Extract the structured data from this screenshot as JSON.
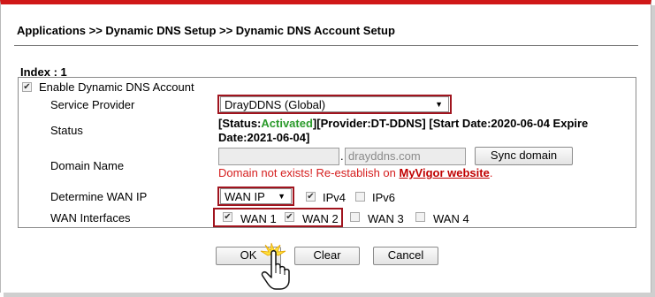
{
  "breadcrumb": "Applications >> Dynamic DNS Setup >> Dynamic DNS Account Setup",
  "index_label": "Index : 1",
  "enable": {
    "label": "Enable Dynamic DNS Account",
    "checked": true
  },
  "service_provider": {
    "label": "Service Provider",
    "value": "DrayDDNS (Global)"
  },
  "status": {
    "label": "Status",
    "prefix": "[Status:",
    "state": "Activated",
    "rest_line1": "][Provider:DT-DDNS] [Start Date:2020-06-04 Expire",
    "line2": "Date:2021-06-04]"
  },
  "domain": {
    "label": "Domain Name",
    "host_value": "",
    "separator": ".",
    "suffix": "drayddns.com",
    "sync_button": "Sync domain",
    "error_text": "Domain not exists! Re-establish on ",
    "error_link": "MyVigor website",
    "error_end": "."
  },
  "wan_ip": {
    "label": "Determine WAN IP",
    "value": "WAN IP",
    "ipv4_label": "IPv4",
    "ipv4_checked": true,
    "ipv6_label": "IPv6",
    "ipv6_checked": false
  },
  "wan_interfaces": {
    "label": "WAN Interfaces",
    "items": [
      {
        "label": "WAN 1",
        "checked": true
      },
      {
        "label": "WAN 2",
        "checked": true
      },
      {
        "label": "WAN 3",
        "checked": false
      },
      {
        "label": "WAN 4",
        "checked": false
      }
    ]
  },
  "buttons": {
    "ok": "OK",
    "clear": "Clear",
    "cancel": "Cancel"
  },
  "colors": {
    "accent_red": "#d01818",
    "highlight_box": "#a0141e",
    "activated_green": "#2b9a2b",
    "error_red": "#d51d1d"
  },
  "icons": {
    "pointer": "hand-pointer-cursor-icon",
    "click_burst": "click-burst-icon"
  }
}
